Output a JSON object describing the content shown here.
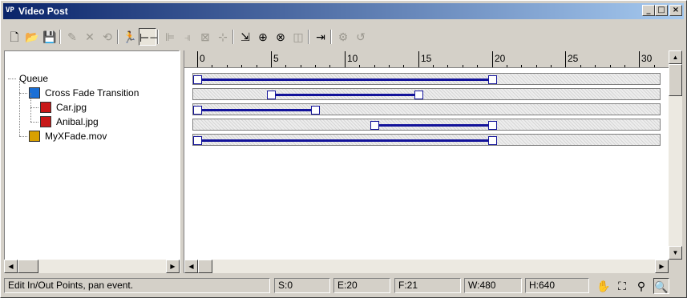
{
  "window": {
    "title": "Video Post",
    "title_icon": "VP",
    "controls": {
      "minimize": "_",
      "maximize": "□",
      "close": "×"
    }
  },
  "toolbar": {
    "buttons": [
      {
        "name": "new-sequence-icon",
        "glyph": "🗋",
        "enabled": true
      },
      {
        "name": "open-sequence-icon",
        "glyph": "📂",
        "enabled": true
      },
      {
        "name": "save-sequence-icon",
        "glyph": "💾",
        "enabled": true
      },
      {
        "name": "edit-current-event-icon",
        "glyph": "✎",
        "enabled": false
      },
      {
        "name": "delete-current-event-icon",
        "glyph": "✕",
        "enabled": false
      },
      {
        "name": "swap-events-icon",
        "glyph": "⟲",
        "enabled": false
      },
      {
        "name": "execute-sequence-icon",
        "glyph": "🏃",
        "enabled": true
      },
      {
        "name": "edit-range-bar-icon",
        "glyph": "⊢⊣",
        "enabled": true,
        "active": true
      },
      {
        "name": "align-left-icon",
        "glyph": "⊫",
        "enabled": false
      },
      {
        "name": "align-right-icon",
        "glyph": "⫣",
        "enabled": false
      },
      {
        "name": "make-same-size-icon",
        "glyph": "⊠",
        "enabled": false
      },
      {
        "name": "abut-selected-icon",
        "glyph": "⊹",
        "enabled": false
      },
      {
        "name": "add-scene-event-icon",
        "glyph": "⇲",
        "enabled": true
      },
      {
        "name": "add-image-input-event-icon",
        "glyph": "⊕",
        "enabled": true
      },
      {
        "name": "add-image-filter-event-icon",
        "glyph": "⊗",
        "enabled": true
      },
      {
        "name": "add-image-layer-event-icon",
        "glyph": "◫",
        "enabled": false
      },
      {
        "name": "add-image-output-event-icon",
        "glyph": "⇥",
        "enabled": true
      },
      {
        "name": "add-external-event-icon",
        "glyph": "⚙",
        "enabled": false
      },
      {
        "name": "add-loop-event-icon",
        "glyph": "↺",
        "enabled": false
      }
    ]
  },
  "tree": {
    "items": [
      {
        "label": "Queue",
        "icon": "queue-root",
        "level": 0
      },
      {
        "label": "Cross Fade Transition",
        "icon": "image-layer-icon",
        "level": 1
      },
      {
        "label": "Car.jpg",
        "icon": "image-input-icon",
        "level": 2
      },
      {
        "label": "Anibal.jpg",
        "icon": "image-input-icon",
        "level": 2
      },
      {
        "label": "MyXFade.mov",
        "icon": "image-output-icon",
        "level": 1
      }
    ]
  },
  "ruler": {
    "frame_min": 0,
    "frame_max": 32,
    "labels": [
      "0",
      "5",
      "10",
      "15",
      "20",
      "25",
      "30"
    ]
  },
  "tracks": [
    {
      "start": 0,
      "end": 20
    },
    {
      "start": 5,
      "end": 15
    },
    {
      "start": 0,
      "end": 8
    },
    {
      "start": 12,
      "end": 20
    },
    {
      "start": 0,
      "end": 20
    }
  ],
  "status": {
    "message": "Edit In/Out Points, pan event.",
    "start": "S:0",
    "end": "E:20",
    "frames": "F:21",
    "width": "W:480",
    "height": "H:640"
  },
  "status_icons": [
    "pan-hand-icon",
    "zoom-extents-icon",
    "zoom-time-icon",
    "zoom-region-icon"
  ],
  "colors": {
    "accent": "#13139a",
    "title_start": "#0a246a",
    "title_end": "#a6caf0",
    "face": "#d4d0c8"
  }
}
